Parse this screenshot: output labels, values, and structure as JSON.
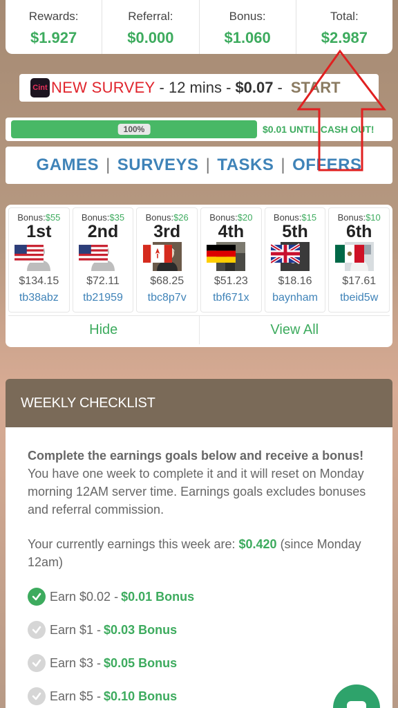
{
  "stats": [
    {
      "label": "Rewards:",
      "value": "$1.927"
    },
    {
      "label": "Referral:",
      "value": "$0.000"
    },
    {
      "label": "Bonus:",
      "value": "$1.060"
    },
    {
      "label": "Total:",
      "value": "$2.987"
    }
  ],
  "survey": {
    "logo_text": "Cint",
    "title": "NEW SURVEY",
    "duration": "- 12 mins -",
    "price": "$0.07",
    "dash": "-",
    "action": "START"
  },
  "progress": {
    "percent_label": "100%",
    "fill_percent": 100,
    "message": "$0.01 UNTIL CASH OUT!",
    "colors": {
      "fill": "#48b866"
    }
  },
  "nav": [
    {
      "label": "GAMES"
    },
    {
      "label": "SURVEYS"
    },
    {
      "label": "TASKS"
    },
    {
      "label": "OFFERS"
    }
  ],
  "nav_separator": "|",
  "leaderboard": {
    "bonus_prefix": "Bonus:",
    "entries": [
      {
        "bonus": "$55",
        "rank": "1st",
        "flag": "us-flag-icon",
        "avatar": "default-avatar",
        "amount": "$134.15",
        "user": "tb38abz"
      },
      {
        "bonus": "$35",
        "rank": "2nd",
        "flag": "us-flag-icon",
        "avatar": "default-avatar",
        "amount": "$72.11",
        "user": "tb21959"
      },
      {
        "bonus": "$26",
        "rank": "3rd",
        "flag": "ca-flag-icon",
        "avatar": "portrait-avatar",
        "amount": "$68.25",
        "user": "tbc8p7v"
      },
      {
        "bonus": "$20",
        "rank": "4th",
        "flag": "de-flag-icon",
        "avatar": "photo-avatar",
        "amount": "$51.23",
        "user": "tbf671x"
      },
      {
        "bonus": "$15",
        "rank": "5th",
        "flag": "uk-flag-icon",
        "avatar": "tiktok-avatar",
        "amount": "$18.16",
        "user": "baynham"
      },
      {
        "bonus": "$10",
        "rank": "6th",
        "flag": "mx-flag-icon",
        "avatar": "photo-avatar-2",
        "amount": "$17.61",
        "user": "tbeid5w"
      }
    ],
    "hide_label": "Hide",
    "view_all_label": "View All"
  },
  "weekly": {
    "title": "WEEKLY CHECKLIST",
    "intro_bold": "Complete the earnings goals below and receive a bonus!",
    "intro_rest": " You have one week to complete it and it will reset on Monday morning 12AM server time. Earnings goals excludes bonuses and referral commission.",
    "earned_prefix": "Your currently earnings this week are: ",
    "earned_value": "$0.420",
    "earned_suffix": " (since Monday 12am)",
    "goals": [
      {
        "text": "Earn $0.02 - ",
        "bonus": "$0.01 Bonus",
        "done": true
      },
      {
        "text": "Earn $1 - ",
        "bonus": "$0.03 Bonus",
        "done": false
      },
      {
        "text": "Earn $3 - ",
        "bonus": "$0.05 Bonus",
        "done": false
      },
      {
        "text": "Earn $5 - ",
        "bonus": "$0.10 Bonus",
        "done": false
      }
    ]
  },
  "colors": {
    "accent_green": "#3dab5e",
    "link_blue": "#3f83b8",
    "survey_red": "#e0242c",
    "header_brown": "#7a6a58",
    "annotation_red": "#e02020"
  }
}
